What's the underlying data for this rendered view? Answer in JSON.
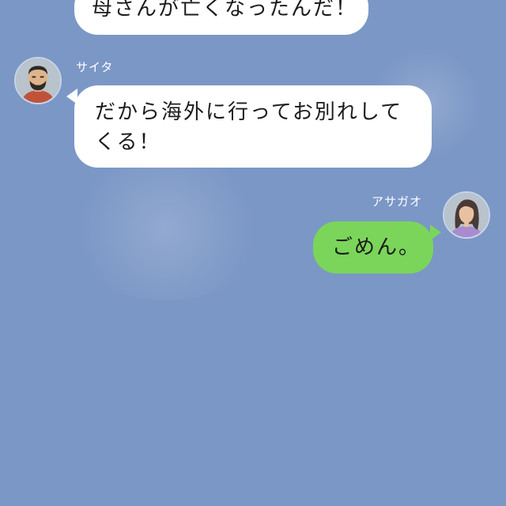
{
  "chat": {
    "messages": [
      {
        "sender": "",
        "text": "母さんが亡くなったんだ！",
        "side": "left"
      },
      {
        "sender": "サイタ",
        "text": "だから海外に行ってお別れしてくる！",
        "side": "left"
      },
      {
        "sender": "アサガオ",
        "text": "ごめん。",
        "side": "right"
      }
    ]
  },
  "icons": {
    "saita_avatar": "man-with-beard-avatar-icon",
    "asagao_avatar": "woman-avatar-icon"
  },
  "colors": {
    "background": "#7b97c6",
    "incoming_bubble": "#ffffff",
    "outgoing_bubble": "#7bd55a",
    "sender_name": "#ffffff"
  }
}
